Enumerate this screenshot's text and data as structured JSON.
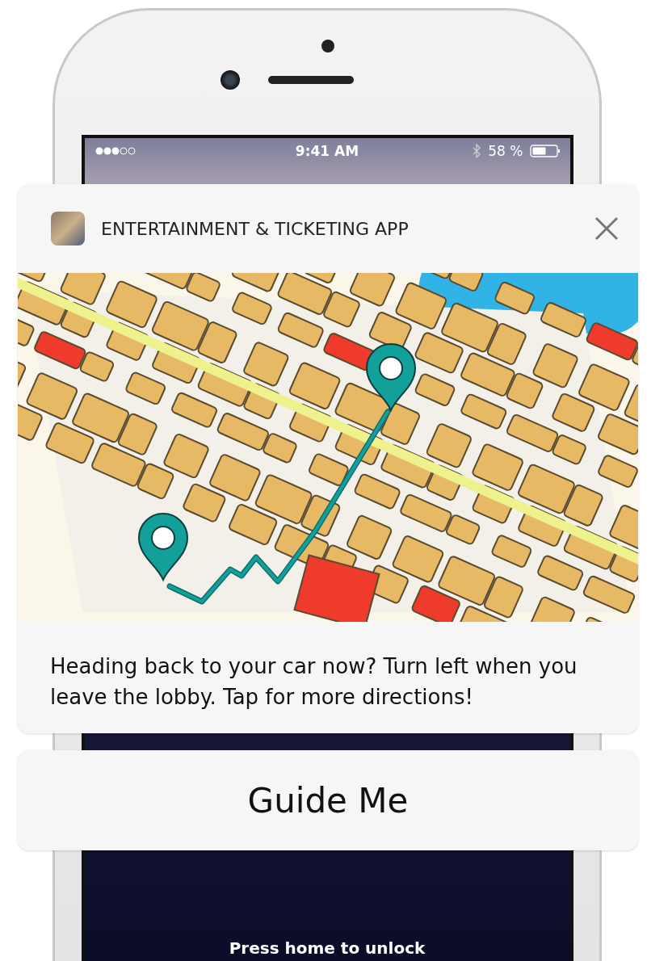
{
  "status_bar": {
    "time": "9:41 AM",
    "battery": "58 %"
  },
  "notification": {
    "app_name": "ENTERTAINMENT & TICKETING APP",
    "message": "Heading back to your car now? Turn left when you leave the lobby. Tap for more directions!"
  },
  "actions": [
    {
      "label": "Guide Me"
    }
  ],
  "lock_screen": {
    "hint": "Press home to unlock"
  }
}
